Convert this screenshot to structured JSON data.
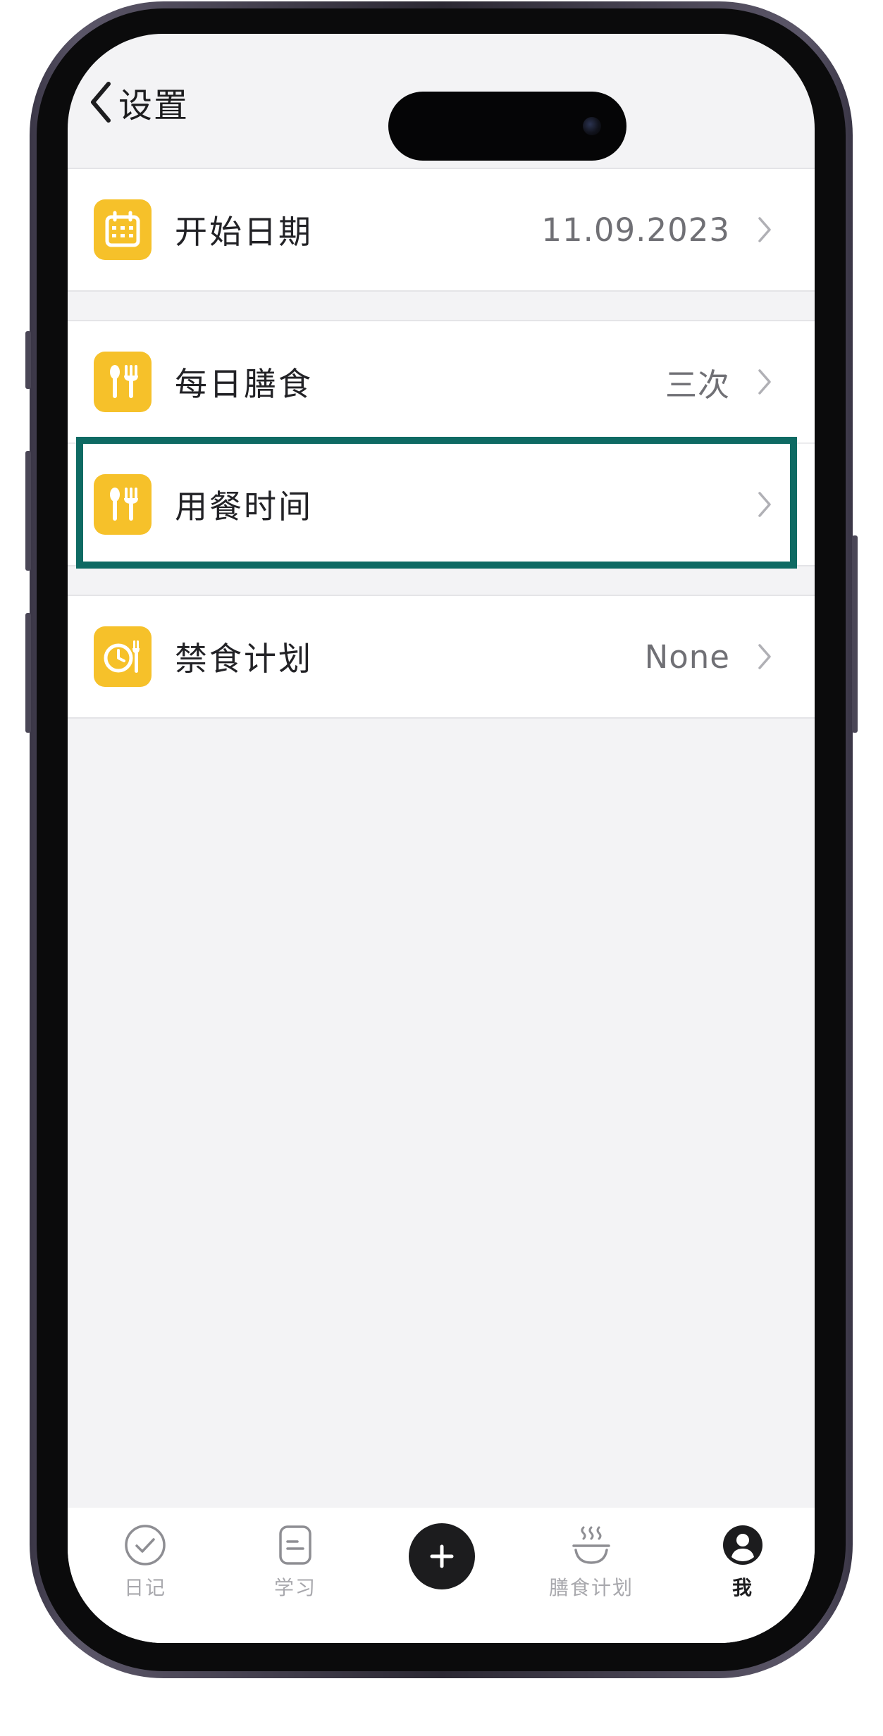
{
  "nav": {
    "back_label": "设置"
  },
  "settings": {
    "start_date": {
      "label": "开始日期",
      "value": "11.09.2023",
      "icon": "calendar-icon"
    },
    "daily_meals": {
      "label": "每日膳食",
      "value": "三次",
      "icon": "utensils-icon"
    },
    "meal_time": {
      "label": "用餐时间",
      "value": "",
      "icon": "utensils-icon",
      "highlighted": true
    },
    "fasting_plan": {
      "label": "禁食计划",
      "value": "None",
      "icon": "clock-utensils-icon"
    }
  },
  "tabbar": {
    "tabs": [
      {
        "label": "日记",
        "icon": "check-circle-icon",
        "active": false
      },
      {
        "label": "学习",
        "icon": "note-icon",
        "active": false
      },
      {
        "label": "",
        "icon": "plus-icon",
        "active": false
      },
      {
        "label": "膳食计划",
        "icon": "steaming-bowl-icon",
        "active": false
      },
      {
        "label": "我",
        "icon": "profile-icon",
        "active": true
      }
    ]
  },
  "colors": {
    "accent_icon": "#f6c12a",
    "highlight_border": "#0e6a63",
    "background": "#f3f3f5"
  }
}
